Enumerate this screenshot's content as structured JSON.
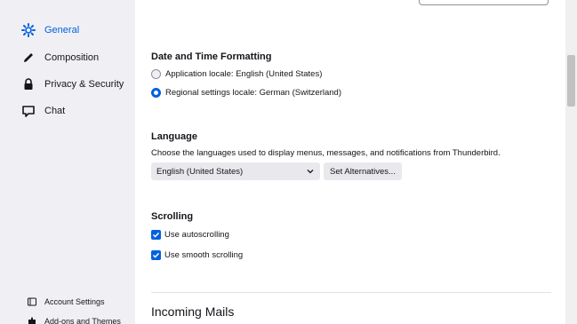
{
  "sidebar": {
    "items": [
      {
        "label": "General",
        "icon": "gear-icon",
        "active": true
      },
      {
        "label": "Composition",
        "icon": "pencil-icon"
      },
      {
        "label": "Privacy & Security",
        "icon": "lock-icon"
      },
      {
        "label": "Chat",
        "icon": "chat-icon"
      }
    ],
    "bottom": [
      {
        "label": "Account Settings",
        "icon": "account-icon"
      },
      {
        "label": "Add-ons and Themes",
        "icon": "puzzle-icon"
      }
    ]
  },
  "content": {
    "datetime": {
      "heading": "Date and Time Formatting",
      "option_app": "Application locale: English (United States)",
      "option_regional": "Regional settings locale: German (Switzerland)",
      "selected": "regional"
    },
    "language": {
      "heading": "Language",
      "description": "Choose the languages used to display menus, messages, and notifications from Thunderbird.",
      "selected_language": "English (United States)",
      "alternatives_button": "Set Alternatives..."
    },
    "scrolling": {
      "heading": "Scrolling",
      "autoscroll": "Use autoscrolling",
      "smooth": "Use smooth scrolling",
      "autoscroll_checked": true,
      "smooth_checked": true
    },
    "incoming": {
      "heading": "Incoming Mails"
    }
  },
  "colors": {
    "accent": "#0061e0",
    "sidebar_bg": "#f0f0f4",
    "button_bg": "#e9e9ed"
  }
}
